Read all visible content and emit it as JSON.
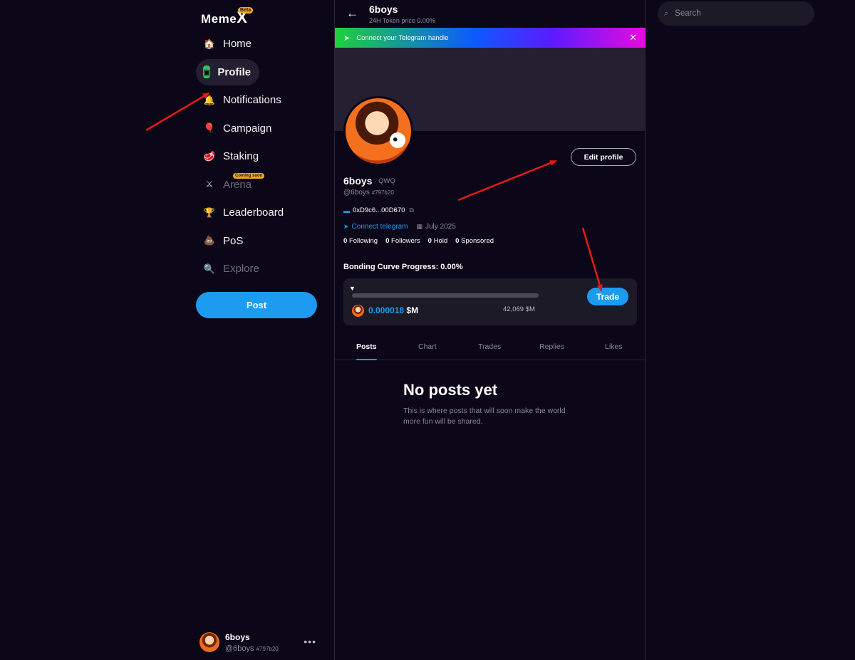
{
  "app": {
    "logo_text": "Meme",
    "logo_x": "X",
    "logo_badge": "Beta"
  },
  "sidebar": {
    "items": [
      {
        "label": "Home",
        "icon": "house-icon",
        "emoji": "🏠"
      },
      {
        "label": "Profile",
        "icon": "profile-screen-icon",
        "emoji": "▣"
      },
      {
        "label": "Notifications",
        "icon": "bell-icon",
        "emoji": "🔔"
      },
      {
        "label": "Campaign",
        "icon": "balloon-icon",
        "emoji": "🎈"
      },
      {
        "label": "Staking",
        "icon": "steak-icon",
        "emoji": "🥩"
      },
      {
        "label": "Arena",
        "icon": "crossed-swords-icon",
        "emoji": "⚔",
        "badge": "Coming soon"
      },
      {
        "label": "Leaderboard",
        "icon": "podium-icon",
        "emoji": "🏆"
      },
      {
        "label": "PoS",
        "icon": "poop-icon",
        "emoji": "💩"
      },
      {
        "label": "Explore",
        "icon": "magnifier-icon",
        "emoji": "🔍"
      }
    ],
    "post_label": "Post",
    "user": {
      "name": "6boys",
      "handle": "@6boys",
      "tag": "#797b20",
      "more": "•••"
    }
  },
  "header": {
    "back": "←",
    "title": "6boys",
    "subtitle": "24H Token price  0.00%"
  },
  "banner": {
    "text": "Connect your Telegram handle",
    "close": "✕"
  },
  "profile": {
    "name": "6boys",
    "ticker": "QWQ",
    "handle": "@6boys",
    "tag": "#797b20",
    "wallet": "0xD9c6...00D670",
    "connect_telegram": "Connect telegram",
    "joined": "July 2025",
    "edit_label": "Edit profile",
    "stats": [
      {
        "count": "0",
        "label": "Following"
      },
      {
        "count": "0",
        "label": "Followers"
      },
      {
        "count": "0",
        "label": "Hold"
      },
      {
        "count": "0",
        "label": "Sponsored"
      }
    ]
  },
  "bonding": {
    "title": "Bonding Curve Progress: 0.00%",
    "progress": 0,
    "price": "0.000018",
    "price_unit": "$M",
    "market_cap": "42,069 $M",
    "trade_label": "Trade"
  },
  "tabs": [
    "Posts",
    "Chart",
    "Trades",
    "Replies",
    "Likes"
  ],
  "empty": {
    "title": "No posts yet",
    "text": "This is where posts that will soon make the world more fun will be shared."
  },
  "search": {
    "placeholder": "Search"
  },
  "colors": {
    "background": "#0c0718",
    "accent": "#1d9bf0",
    "annotation": "#e81818"
  }
}
